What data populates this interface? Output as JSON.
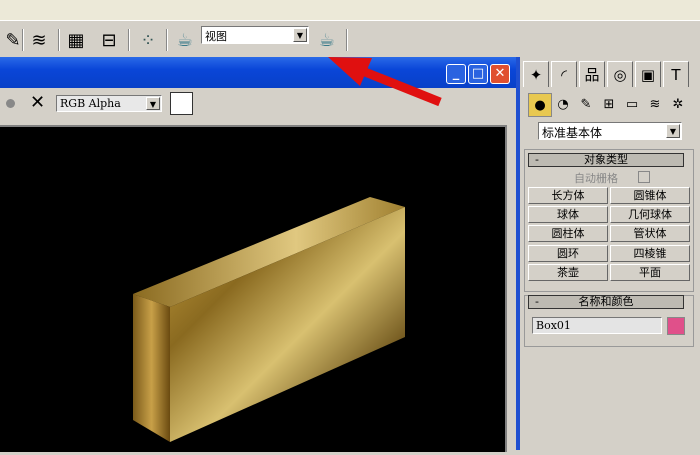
{
  "toolbar": {
    "view_dropdown": "视图",
    "icons": [
      "edit-named-selection-icon",
      "layer-manager-icon",
      "track-view-icon",
      "schematic-view-icon",
      "material-editor-icon",
      "render-scene-icon",
      "quick-render-icon"
    ]
  },
  "render_window": {
    "channel_dropdown": "RGB Alpha",
    "buttons": {
      "minimize": "_",
      "maximize": "□",
      "close": "✕"
    }
  },
  "command_panel": {
    "tabs": [
      "create",
      "modify",
      "hierarchy",
      "motion",
      "display",
      "utilities"
    ],
    "subtabs": [
      "geometry",
      "shapes",
      "lights",
      "cameras",
      "helpers",
      "space-warps",
      "systems"
    ],
    "category_dropdown": "标准基本体",
    "object_type": {
      "title": "对象类型",
      "autogrid_label": "自动栅格",
      "buttons": [
        "长方体",
        "圆锥体",
        "球体",
        "几何球体",
        "圆柱体",
        "管状体",
        "圆环",
        "四棱锥",
        "茶壶",
        "平面"
      ]
    },
    "name_color": {
      "title": "名称和颜色",
      "name_value": "Box01",
      "color": "#e0508a"
    }
  },
  "colors": {
    "accent": "#0a46d8",
    "arrow": "#e01010"
  }
}
